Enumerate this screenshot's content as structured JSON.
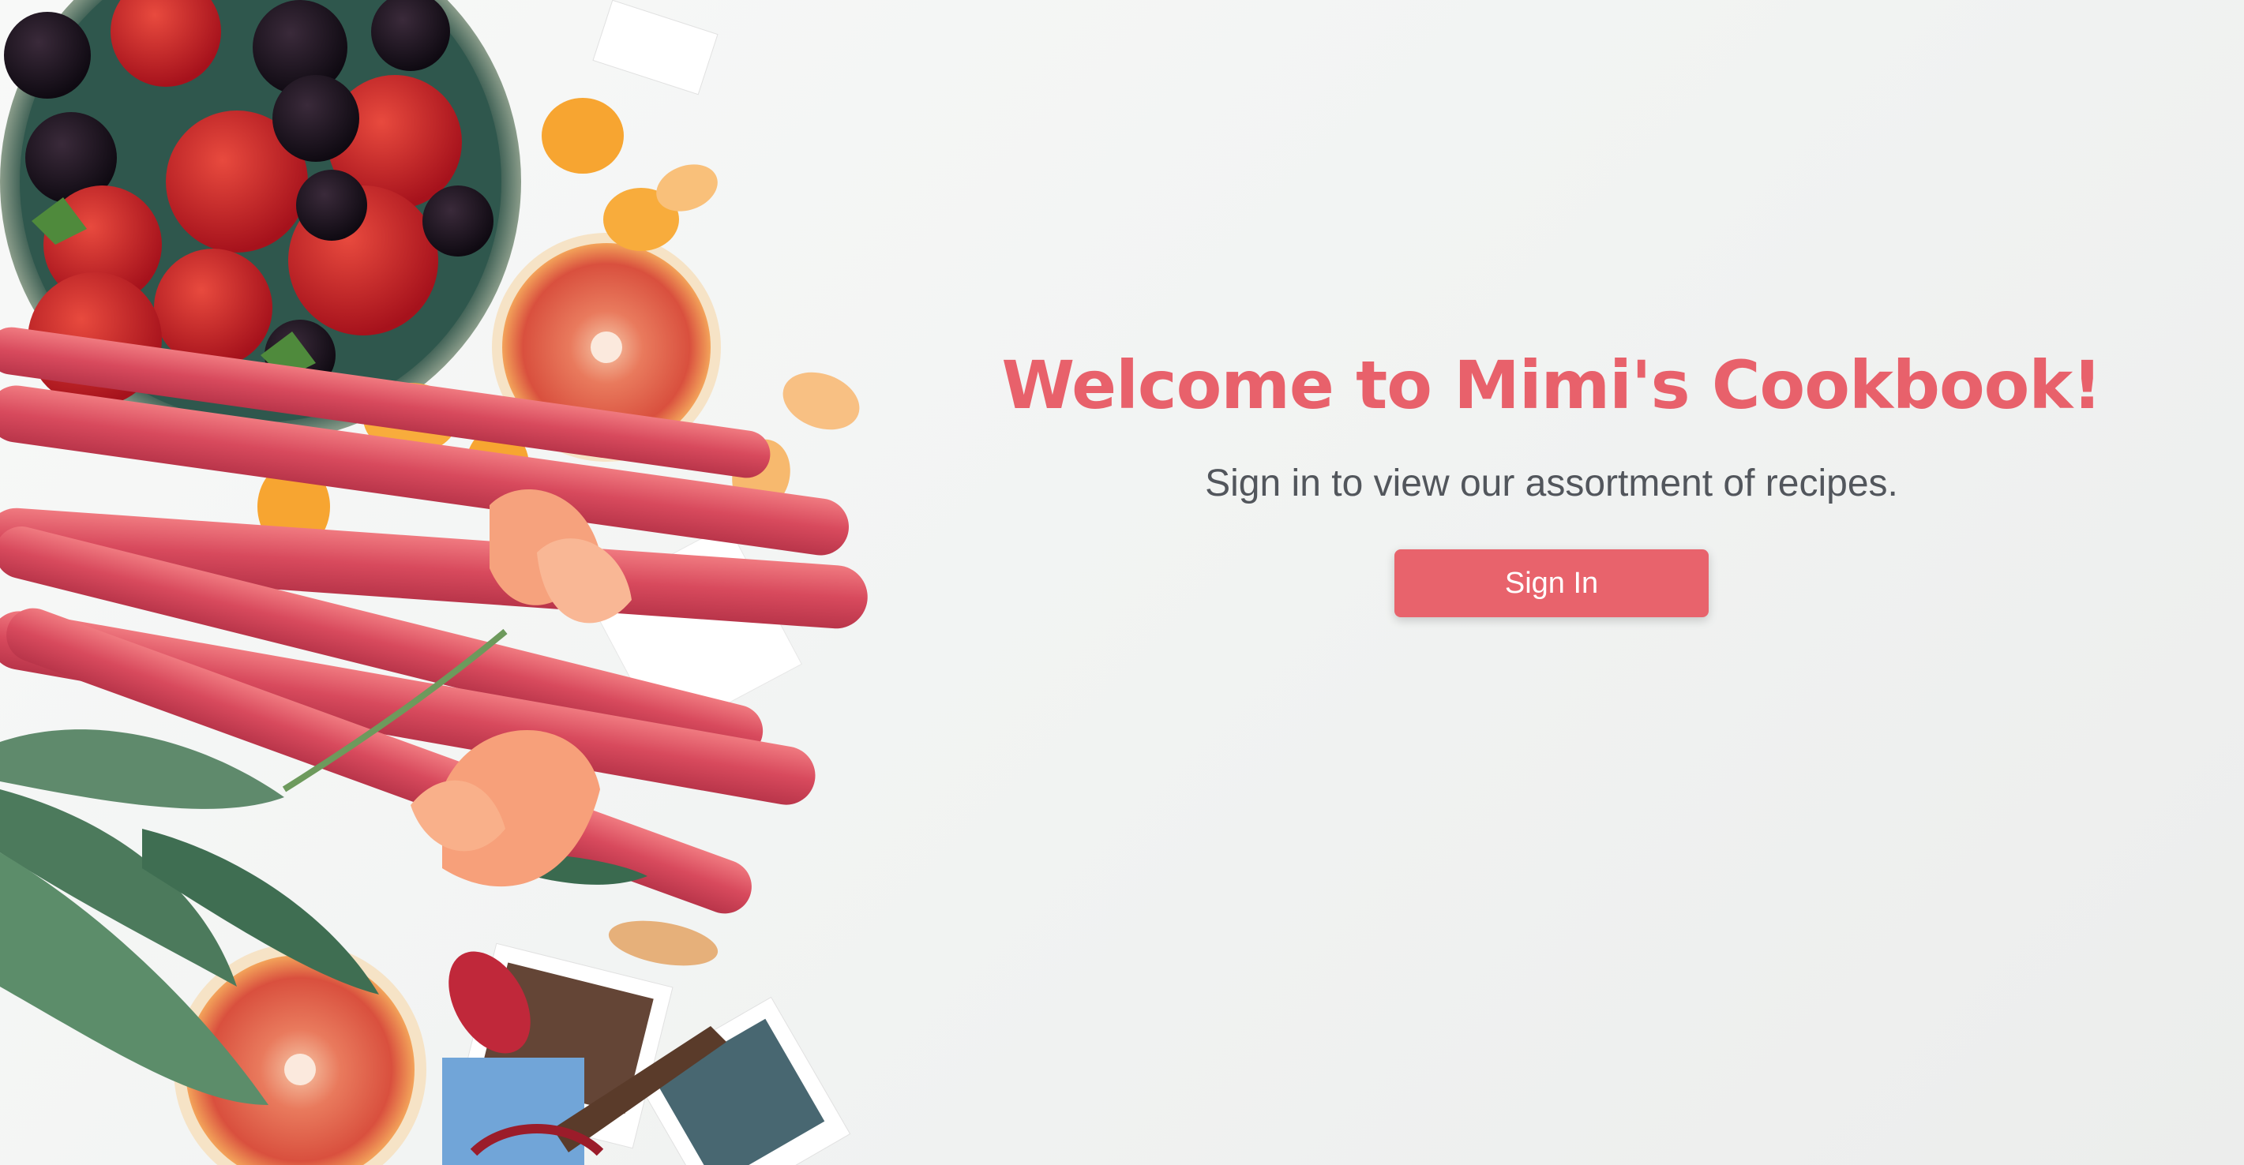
{
  "page": {
    "title": "Welcome to Mimi's Cookbook!",
    "subtitle": "Sign in to view our assortment of recipes.",
    "sign_in_label": "Sign In"
  },
  "colors": {
    "accent": "#e8616b",
    "button": "#e8636c",
    "subtitle": "#52565c",
    "background": "#f3f4f3"
  },
  "hero_image": {
    "icon": "food-flatlay-illustration"
  }
}
